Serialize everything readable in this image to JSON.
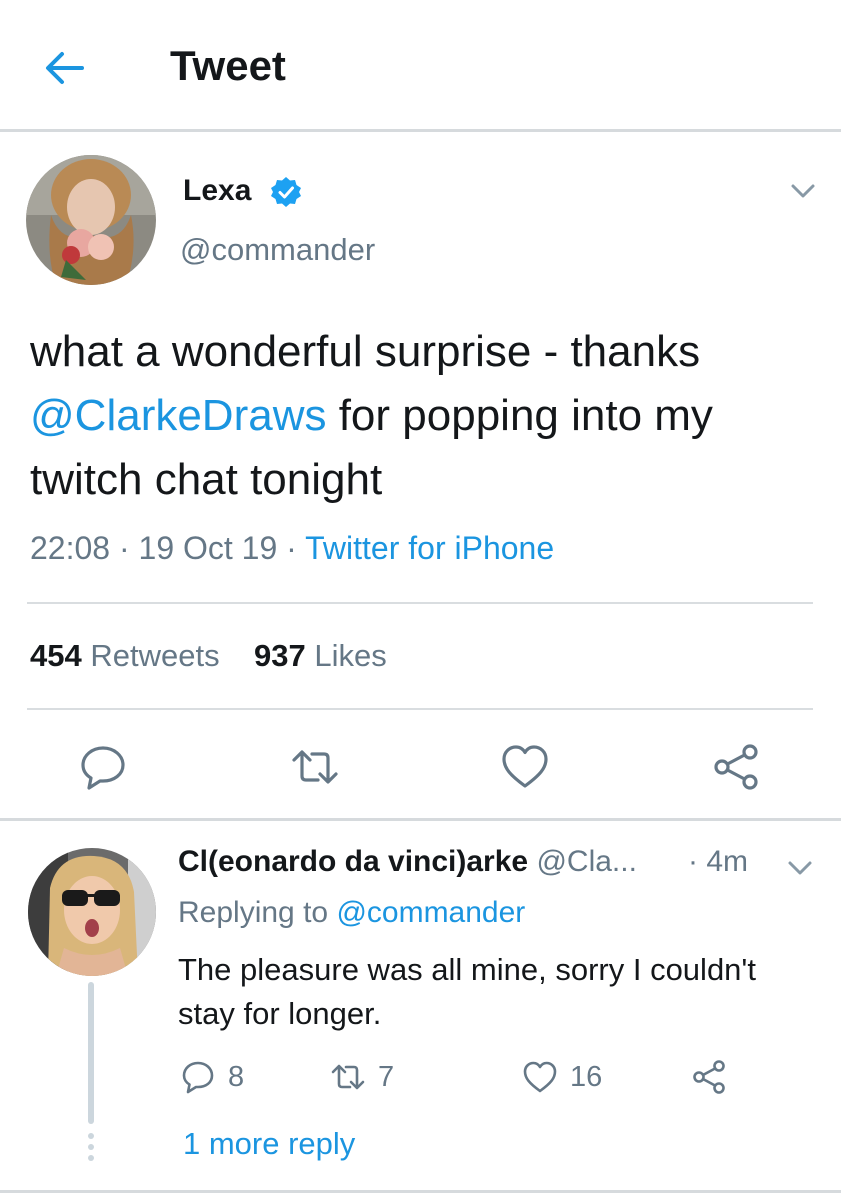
{
  "header": {
    "title": "Tweet"
  },
  "tweet": {
    "author_name": "Lexa",
    "author_handle": "@commander",
    "text_part1": "what a wonderful surprise - thanks ",
    "mention": "@ClarkeDraws",
    "text_part2": " for popping into my twitch chat tonight",
    "time": "22:08",
    "date": "19 Oct 19",
    "source": "Twitter for iPhone",
    "retweets_count": "454",
    "retweets_label": "Retweets",
    "likes_count": "937",
    "likes_label": "Likes"
  },
  "reply": {
    "name": "Cl(eonardo da vinci)arke",
    "handle": "@Cla...",
    "time": "4m",
    "replying_label": "Replying to",
    "replying_to": "@commander",
    "text": "The pleasure was all mine, sorry I couldn't stay for longer.",
    "reply_count": "8",
    "retweet_count": "7",
    "like_count": "16",
    "more_replies": "1 more reply"
  },
  "colors": {
    "accent": "#1b95e0",
    "secondary_text": "#657786",
    "divider": "#d9dde0"
  },
  "icons": [
    "back-arrow-icon",
    "verified-badge-icon",
    "chevron-down-icon",
    "reply-icon",
    "retweet-icon",
    "like-icon",
    "share-icon"
  ]
}
